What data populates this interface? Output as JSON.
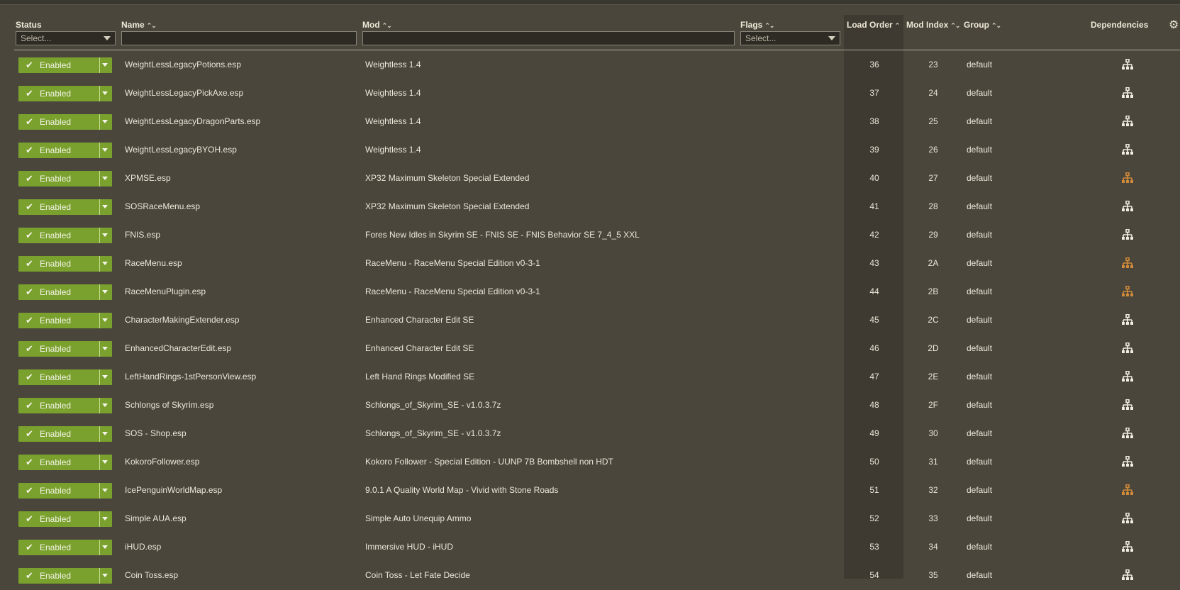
{
  "columns": {
    "status": "Status",
    "name": "Name",
    "mod": "Mod",
    "flags": "Flags",
    "load_order": "Load Order",
    "mod_index": "Mod Index",
    "group": "Group",
    "dependencies": "Dependencies"
  },
  "sort_icons": {
    "sortable": "⌃⌄",
    "ascending": "⌃"
  },
  "filters": {
    "status_placeholder": "Select...",
    "name_value": "",
    "mod_value": "",
    "flags_placeholder": "Select..."
  },
  "colors": {
    "enabled": "#7aa12e",
    "dep_ok": "#f0ece0",
    "dep_warn": "#d08a3a"
  },
  "rows": [
    {
      "status": "Enabled",
      "name": "WeightLessLegacyPotions.esp",
      "mod": "Weightless 1.4",
      "load_order": "36",
      "mod_index": "23",
      "group": "default",
      "dep": "ok"
    },
    {
      "status": "Enabled",
      "name": "WeightLessLegacyPickAxe.esp",
      "mod": "Weightless 1.4",
      "load_order": "37",
      "mod_index": "24",
      "group": "default",
      "dep": "ok"
    },
    {
      "status": "Enabled",
      "name": "WeightLessLegacyDragonParts.esp",
      "mod": "Weightless 1.4",
      "load_order": "38",
      "mod_index": "25",
      "group": "default",
      "dep": "ok"
    },
    {
      "status": "Enabled",
      "name": "WeightLessLegacyBYOH.esp",
      "mod": "Weightless 1.4",
      "load_order": "39",
      "mod_index": "26",
      "group": "default",
      "dep": "ok"
    },
    {
      "status": "Enabled",
      "name": "XPMSE.esp",
      "mod": "XP32 Maximum Skeleton Special Extended",
      "load_order": "40",
      "mod_index": "27",
      "group": "default",
      "dep": "warn"
    },
    {
      "status": "Enabled",
      "name": "SOSRaceMenu.esp",
      "mod": "XP32 Maximum Skeleton Special Extended",
      "load_order": "41",
      "mod_index": "28",
      "group": "default",
      "dep": "ok"
    },
    {
      "status": "Enabled",
      "name": "FNIS.esp",
      "mod": "Fores New Idles in Skyrim SE - FNIS SE - FNIS Behavior SE 7_4_5 XXL",
      "load_order": "42",
      "mod_index": "29",
      "group": "default",
      "dep": "ok"
    },
    {
      "status": "Enabled",
      "name": "RaceMenu.esp",
      "mod": "RaceMenu - RaceMenu Special Edition v0-3-1",
      "load_order": "43",
      "mod_index": "2A",
      "group": "default",
      "dep": "warn"
    },
    {
      "status": "Enabled",
      "name": "RaceMenuPlugin.esp",
      "mod": "RaceMenu - RaceMenu Special Edition v0-3-1",
      "load_order": "44",
      "mod_index": "2B",
      "group": "default",
      "dep": "warn"
    },
    {
      "status": "Enabled",
      "name": "CharacterMakingExtender.esp",
      "mod": "Enhanced Character Edit SE",
      "load_order": "45",
      "mod_index": "2C",
      "group": "default",
      "dep": "ok"
    },
    {
      "status": "Enabled",
      "name": "EnhancedCharacterEdit.esp",
      "mod": "Enhanced Character Edit SE",
      "load_order": "46",
      "mod_index": "2D",
      "group": "default",
      "dep": "ok"
    },
    {
      "status": "Enabled",
      "name": "LeftHandRings-1stPersonView.esp",
      "mod": "Left Hand Rings Modified SE",
      "load_order": "47",
      "mod_index": "2E",
      "group": "default",
      "dep": "ok"
    },
    {
      "status": "Enabled",
      "name": "Schlongs of Skyrim.esp",
      "mod": "Schlongs_of_Skyrim_SE - v1.0.3.7z",
      "load_order": "48",
      "mod_index": "2F",
      "group": "default",
      "dep": "ok"
    },
    {
      "status": "Enabled",
      "name": "SOS - Shop.esp",
      "mod": "Schlongs_of_Skyrim_SE - v1.0.3.7z",
      "load_order": "49",
      "mod_index": "30",
      "group": "default",
      "dep": "ok"
    },
    {
      "status": "Enabled",
      "name": "KokoroFollower.esp",
      "mod": "Kokoro Follower - Special Edition - UUNP 7B Bombshell non HDT",
      "load_order": "50",
      "mod_index": "31",
      "group": "default",
      "dep": "ok"
    },
    {
      "status": "Enabled",
      "name": "IcePenguinWorldMap.esp",
      "mod": "9.0.1 A Quality World Map - Vivid with Stone Roads",
      "load_order": "51",
      "mod_index": "32",
      "group": "default",
      "dep": "warn"
    },
    {
      "status": "Enabled",
      "name": "Simple AUA.esp",
      "mod": "Simple Auto Unequip Ammo",
      "load_order": "52",
      "mod_index": "33",
      "group": "default",
      "dep": "ok"
    },
    {
      "status": "Enabled",
      "name": "iHUD.esp",
      "mod": "Immersive HUD - iHUD",
      "load_order": "53",
      "mod_index": "34",
      "group": "default",
      "dep": "ok"
    },
    {
      "status": "Enabled",
      "name": "Coin Toss.esp",
      "mod": "Coin Toss - Let Fate Decide",
      "load_order": "54",
      "mod_index": "35",
      "group": "default",
      "dep": "ok"
    }
  ]
}
